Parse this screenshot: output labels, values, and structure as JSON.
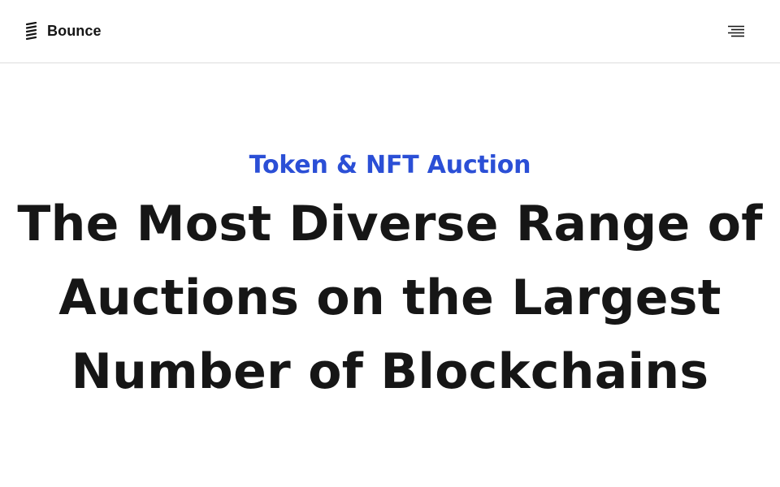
{
  "header": {
    "brand_name": "Bounce",
    "logo_icon": "bounce-logo-icon",
    "menu_icon": "hamburger-menu-icon"
  },
  "hero": {
    "eyebrow": "Token & NFT Auction",
    "headline_lines": [
      "The Most Diverse Range of",
      "Auctions on the Largest",
      "Number of Blockchains"
    ]
  },
  "colors": {
    "accent": "#2b4fd6",
    "text": "#161616",
    "divider": "#dcdcdc",
    "background": "#ffffff"
  }
}
